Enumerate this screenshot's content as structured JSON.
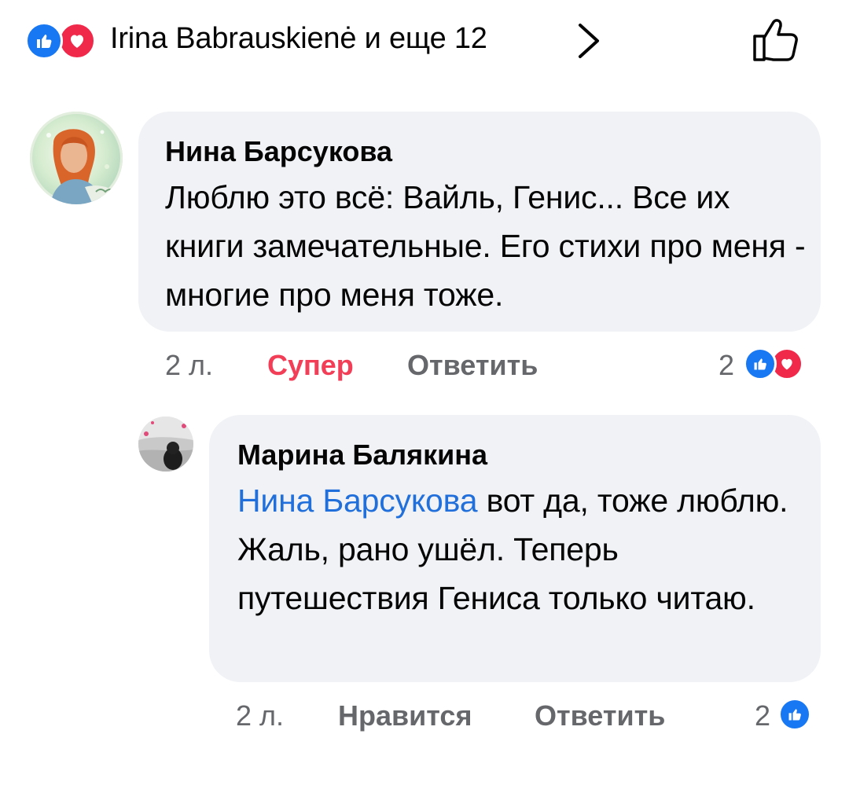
{
  "header": {
    "reactors_text": "Irina Babrauskienė и еще 12",
    "reactions": [
      "like-icon",
      "love-icon"
    ]
  },
  "comments": [
    {
      "author": "Нина Барсукова",
      "text": "Люблю это всё: Вайль, Генис... Все их книги замечательные. Его стихи про меня - многие про меня тоже.",
      "time": "2 л.",
      "reaction_label": "Супер",
      "reply_label": "Ответить",
      "reaction_count": "2",
      "reactions": [
        "like-icon",
        "love-icon"
      ]
    },
    {
      "author": "Марина Балякина",
      "mention": "Нина Барсукова",
      "text": " вот да, тоже люблю. Жаль, рано ушёл. Теперь путешествия Гениса только читаю.",
      "time": "2 л.",
      "like_label": "Нравится",
      "reply_label": "Ответить",
      "reaction_count": "2",
      "reactions": [
        "like-icon"
      ]
    }
  ],
  "colors": {
    "like_blue": "#1877f2",
    "love_red": "#f0284a",
    "super_active": "#f33e58",
    "mention_blue": "#216fdb",
    "bubble_bg": "#f0f2f5",
    "meta_gray": "#65676b"
  }
}
